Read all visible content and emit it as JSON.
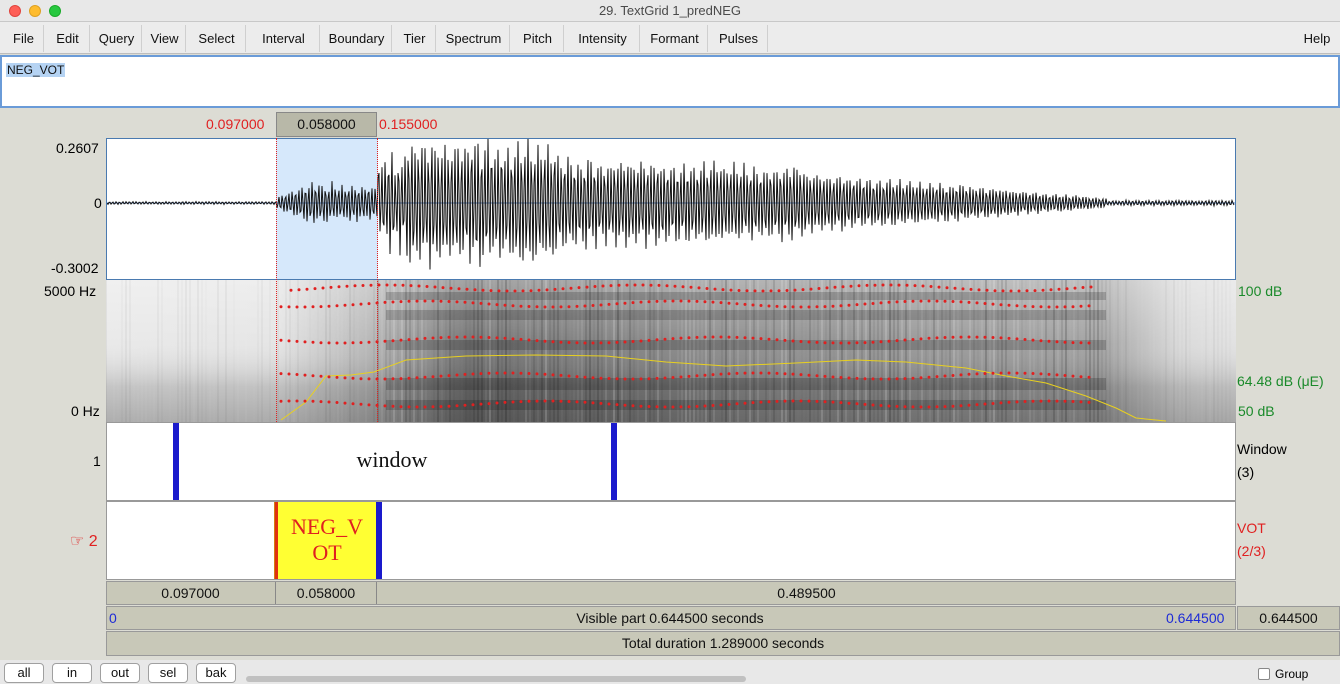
{
  "window": {
    "title": "29. TextGrid 1_predNEG"
  },
  "menu": [
    "File",
    "Edit",
    "Query",
    "View",
    "Select",
    "Interval",
    "Boundary",
    "Tier",
    "Spectrum",
    "Pitch",
    "Intensity",
    "Formant",
    "Pulses"
  ],
  "help": "Help",
  "text_field": {
    "value": "NEG_VOT"
  },
  "selection": {
    "left": "0.097000",
    "width": "0.058000",
    "right": "0.155000"
  },
  "waveform": {
    "max": "0.2607",
    "zero": "0",
    "min": "-0.3002"
  },
  "spectrogram": {
    "top_hz": "5000 Hz",
    "bottom_hz": "0 Hz",
    "top_db": "100 dB",
    "mid_db": "64.48 dB (μE)",
    "bottom_db": "50 dB"
  },
  "tiers": [
    {
      "number": "1",
      "name": "Window",
      "count": "(3)",
      "interval_text": "window"
    },
    {
      "number": "2",
      "pointer": "☞",
      "name": "VOT",
      "count": "(2/3)",
      "interval_text": "NEG_V\nOT"
    }
  ],
  "durations": {
    "seg1": "0.097000",
    "seg2": "0.058000",
    "seg3": "0.489500"
  },
  "visible": {
    "start": "0",
    "label": "Visible part 0.644500 seconds",
    "end": "0.644500",
    "total_right": "0.644500"
  },
  "total": {
    "label": "Total duration 1.289000 seconds"
  },
  "buttons": {
    "all": "all",
    "in": "in",
    "out": "out",
    "sel": "sel",
    "bak": "bak"
  },
  "group_label": "Group",
  "colors": {
    "selection": "#d6e8fb",
    "boundary": "#1a1acc",
    "highlight": "#ffff33",
    "pitch": "#e8d020",
    "formant": "#e02020"
  }
}
